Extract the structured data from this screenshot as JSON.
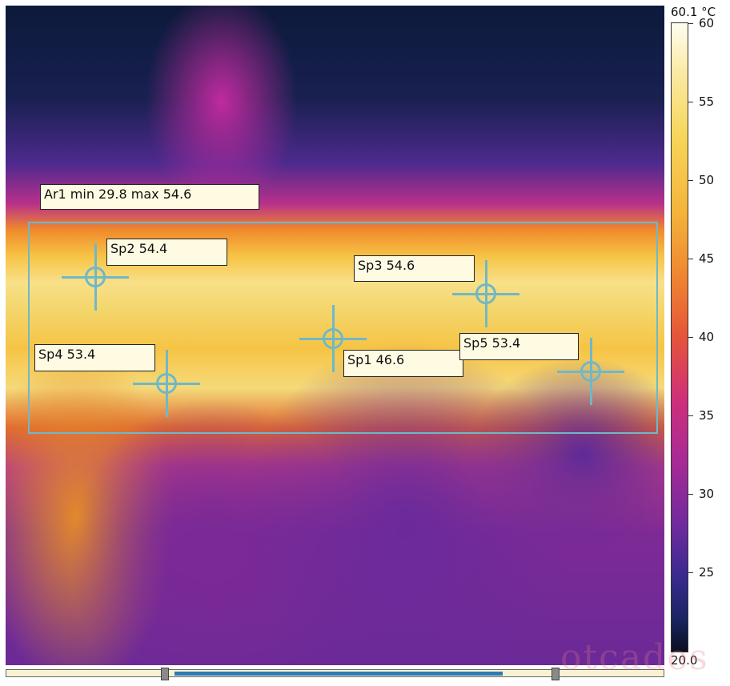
{
  "scale": {
    "max_label": "60.1 °C",
    "min_label": "20.0",
    "ticks": [
      "60",
      "55",
      "50",
      "45",
      "40",
      "35",
      "30",
      "25"
    ]
  },
  "area": {
    "label": "Ar1 min 29.8 max 54.6"
  },
  "spots": [
    {
      "label": "Sp2 54.4"
    },
    {
      "label": "Sp3 54.6"
    },
    {
      "label": "Sp1 46.6"
    },
    {
      "label": "Sp5 53.4"
    },
    {
      "label": "Sp4 53.4"
    }
  ],
  "watermark": "otcades",
  "colors": {
    "overlay": "#6fb8c8",
    "slider_range": "#2f7bb5"
  }
}
